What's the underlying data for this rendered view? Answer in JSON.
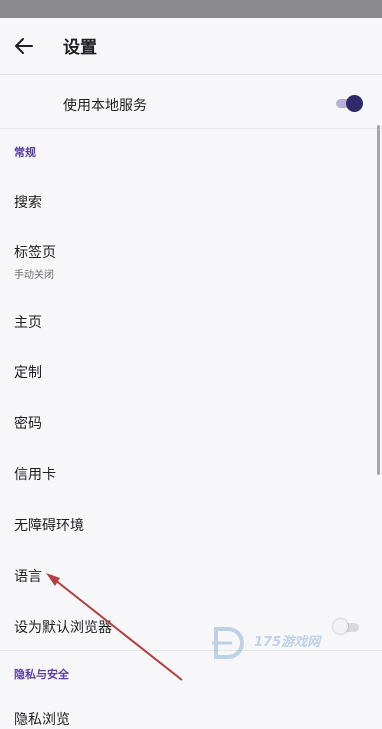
{
  "header": {
    "title": "设置"
  },
  "local_service": {
    "label": "使用本地服务",
    "enabled": true
  },
  "section_general": "常规",
  "general_items": {
    "search": "搜索",
    "tabs": "标签页",
    "tabs_sub": "手动关闭",
    "home": "主页",
    "customize": "定制",
    "passwords": "密码",
    "credit_card": "信用卡",
    "accessibility": "无障碍环境",
    "language": "语言",
    "default_browser": "设为默认浏览器"
  },
  "default_browser_enabled": false,
  "section_privacy": "隐私与安全",
  "privacy_items": {
    "private_browsing": "隐私浏览"
  },
  "watermark": {
    "text": "175游戏网"
  },
  "colors": {
    "accent": "#5b3fa5",
    "toggle_thumb": "#2f2a6b",
    "annotation_arrow": "#b3403e"
  }
}
